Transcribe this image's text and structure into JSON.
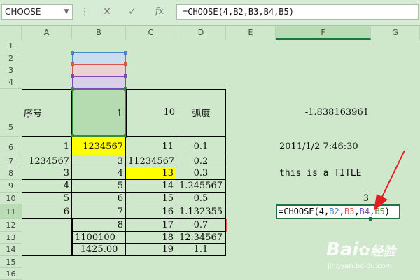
{
  "namebox": {
    "value": "CHOOSE"
  },
  "formula_bar": {
    "cancel_glyph": "✕",
    "enter_glyph": "✓",
    "fx_label": "fx",
    "formula": "=CHOOSE(4,B2,B3,B4,B5)"
  },
  "columns": [
    "A",
    "B",
    "C",
    "D",
    "E",
    "F",
    "G"
  ],
  "rows": [
    "1",
    "2",
    "3",
    "4",
    "5",
    "6",
    "7",
    "8",
    "9",
    "10",
    "11",
    "12",
    "13",
    "14",
    "15",
    "16"
  ],
  "cells": {
    "A5": "序号",
    "B5": "1",
    "C5": "10",
    "D5": "弧度",
    "F5": "-1.838163961",
    "A6": "1",
    "B6": "1234567",
    "C6": "11",
    "D6": "0.1",
    "F6": "2011/1/2 7:46:30",
    "A7": "1234567",
    "B7": "3",
    "C7": "11234567",
    "D7": "0.2",
    "A8": "3",
    "B8": "4",
    "C8": "13",
    "D8": "0.3",
    "F8": "this is a TITLE",
    "A9": "4",
    "B9": "5",
    "C9": "14",
    "D9": "1.245567",
    "A10": "5",
    "B10": "6",
    "C10": "15",
    "D10": "0.5",
    "F10": "3",
    "A11": "6",
    "B11": "7",
    "C11": "16",
    "D11": "1.132355",
    "B12": "8",
    "C12": "17",
    "D12": "0.7",
    "B13": "1100100",
    "C13": "18",
    "D13": "12.34567",
    "B14": "1425.00",
    "C14": "19",
    "D14": "1.1"
  },
  "edit_formula": {
    "prefix": "=CHOOSE(4,",
    "ref1": "B2",
    "sep1": ",",
    "ref2": "B3",
    "sep2": ",",
    "ref3": "B4",
    "sep3": ",",
    "ref4": "B5",
    "suffix": ")"
  },
  "colors": {
    "ref1": "#4a86c8",
    "ref2": "#d9534f",
    "ref3": "#7b4bb3",
    "ref4": "#3a8a3a",
    "highlight": "#ffff00",
    "arrow": "#e02020"
  },
  "watermark": {
    "brand": "Bai",
    "site": "jingyan.baidu.com"
  }
}
